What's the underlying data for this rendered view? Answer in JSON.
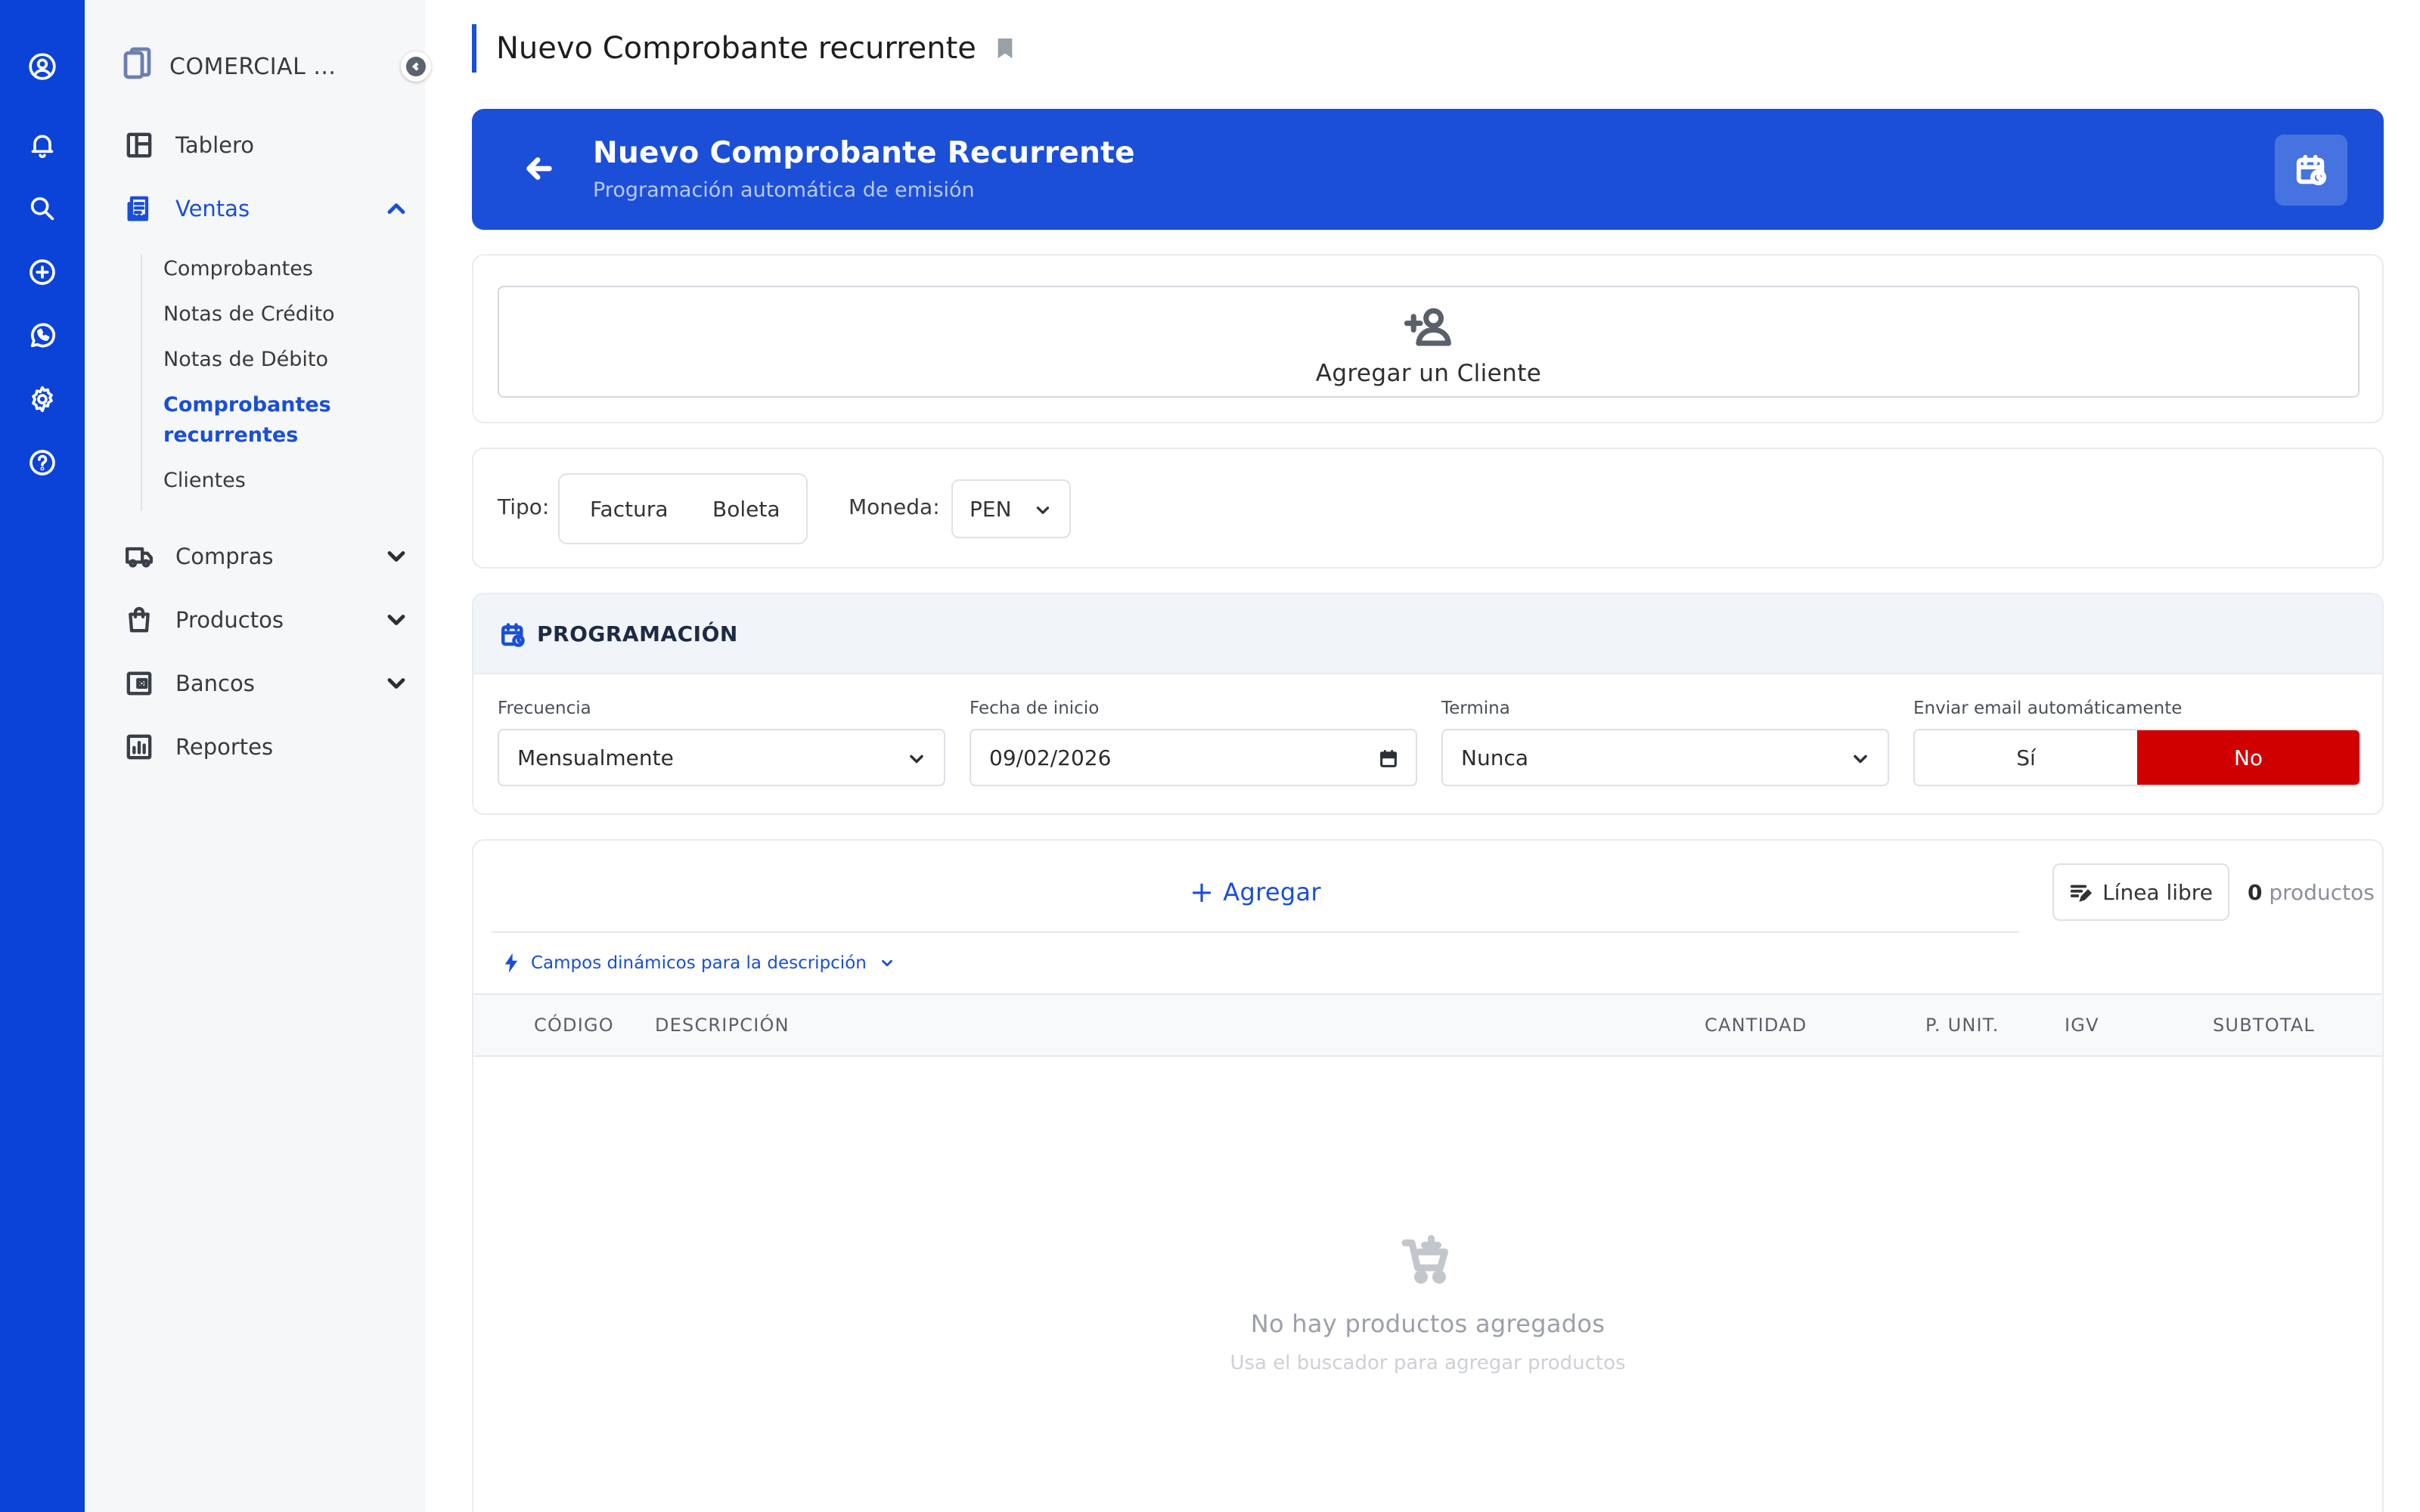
{
  "rail": {
    "icons": [
      "account-icon",
      "bell-icon",
      "search-icon",
      "add-circle-icon",
      "whatsapp-icon",
      "gear-icon",
      "help-icon"
    ]
  },
  "sidebar": {
    "company": "COMERCIAL ...",
    "items": [
      {
        "label": "Tablero"
      },
      {
        "label": "Ventas"
      },
      {
        "label": "Compras"
      },
      {
        "label": "Productos"
      },
      {
        "label": "Bancos"
      },
      {
        "label": "Reportes"
      }
    ],
    "ventas_sub": [
      {
        "label": "Comprobantes"
      },
      {
        "label": "Notas de Crédito"
      },
      {
        "label": "Notas de Débito"
      },
      {
        "label": "Comprobantes recurrentes"
      },
      {
        "label": "Clientes"
      }
    ]
  },
  "page": {
    "title": "Nuevo Comprobante recurrente"
  },
  "banner": {
    "title": "Nuevo Comprobante Recurrente",
    "subtitle": "Programación automática de emisión"
  },
  "client": {
    "add_label": "Agregar un Cliente"
  },
  "type": {
    "label": "Tipo:",
    "options": [
      "Factura",
      "Boleta"
    ],
    "currency_label": "Moneda:",
    "currency_value": "PEN"
  },
  "schedule": {
    "title": "PROGRAMACIÓN",
    "frequency_label": "Frecuencia",
    "frequency_value": "Mensualmente",
    "start_label": "Fecha de inicio",
    "start_value": "09/02/2026",
    "ends_label": "Termina",
    "ends_value": "Nunca",
    "email_label": "Enviar email automáticamente",
    "email_yes": "Sí",
    "email_no": "No",
    "email_selected": "No"
  },
  "products": {
    "add_label": "Agregar",
    "free_line_label": "Línea libre",
    "count_number": "0",
    "count_unit": "productos",
    "dynamic_fields": "Campos dinámicos para la descripción",
    "columns": [
      "CÓDIGO",
      "DESCRIPCIÓN",
      "CANTIDAD",
      "P. UNIT.",
      "IGV",
      "SUBTOTAL"
    ],
    "empty_title": "No hay productos agregados",
    "empty_subtitle": "Usa el buscador para agregar productos"
  },
  "colors": {
    "brand": "#0b43d9",
    "banner": "#1c4fd8",
    "accent": "#1a4fd6",
    "toggle_active": "#d00000"
  }
}
